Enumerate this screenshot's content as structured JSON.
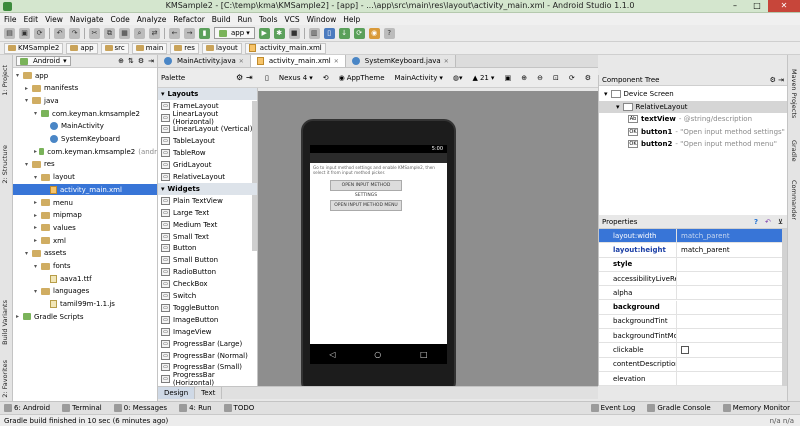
{
  "window": {
    "title": "KMSample2 - [C:\\temp\\kma\\KMSample2] - [app] - ...\\app\\src\\main\\res\\layout\\activity_main.xml - Android Studio 1.1.0",
    "minimize": "–",
    "maximize": "□",
    "close": "✕"
  },
  "menu": [
    "File",
    "Edit",
    "View",
    "Navigate",
    "Code",
    "Analyze",
    "Refactor",
    "Build",
    "Run",
    "Tools",
    "VCS",
    "Window",
    "Help"
  ],
  "toolbar": {
    "app_selector": "app"
  },
  "breadcrumbs": [
    "KMSample2",
    "app",
    "src",
    "main",
    "res",
    "layout",
    "activity_main.xml"
  ],
  "left_tabs": [
    "1: Project",
    "2: Structure",
    "Build Variants",
    "2: Favorites"
  ],
  "right_tabs": [
    "Maven Projects",
    "Gradle",
    "Commander"
  ],
  "project": {
    "view": "Android",
    "tree": [
      {
        "label": "app",
        "indent": 0,
        "icon": "folder",
        "arrow": "▾"
      },
      {
        "label": "manifests",
        "indent": 1,
        "icon": "folder",
        "arrow": "▸"
      },
      {
        "label": "java",
        "indent": 1,
        "icon": "folder",
        "arrow": "▾"
      },
      {
        "label": "com.keyman.kmsample2",
        "indent": 2,
        "icon": "package",
        "arrow": "▾"
      },
      {
        "label": "MainActivity",
        "indent": 3,
        "icon": "class",
        "arrow": ""
      },
      {
        "label": "SystemKeyboard",
        "indent": 3,
        "icon": "class",
        "arrow": ""
      },
      {
        "label": "com.keyman.kmsample2",
        "suffix": "(andr",
        "indent": 2,
        "icon": "package",
        "arrow": "▸"
      },
      {
        "label": "res",
        "indent": 1,
        "icon": "folder",
        "arrow": "▾"
      },
      {
        "label": "layout",
        "indent": 2,
        "icon": "folder",
        "arrow": "▾"
      },
      {
        "label": "activity_main.xml",
        "indent": 3,
        "icon": "xml",
        "arrow": "",
        "selected": true
      },
      {
        "label": "menu",
        "indent": 2,
        "icon": "folder",
        "arrow": "▸"
      },
      {
        "label": "mipmap",
        "indent": 2,
        "icon": "folder",
        "arrow": "▸"
      },
      {
        "label": "values",
        "indent": 2,
        "icon": "folder",
        "arrow": "▸"
      },
      {
        "label": "xml",
        "indent": 2,
        "icon": "folder",
        "arrow": "▸"
      },
      {
        "label": "assets",
        "indent": 1,
        "icon": "folder",
        "arrow": "▾"
      },
      {
        "label": "fonts",
        "indent": 2,
        "icon": "folder",
        "arrow": "▾"
      },
      {
        "label": "aava1.ttf",
        "indent": 3,
        "icon": "file",
        "arrow": ""
      },
      {
        "label": "languages",
        "indent": 2,
        "icon": "folder",
        "arrow": "▾"
      },
      {
        "label": "tamil99m-1.1.js",
        "indent": 3,
        "icon": "file",
        "arrow": ""
      },
      {
        "label": "Gradle Scripts",
        "indent": 0,
        "icon": "gradle",
        "arrow": "▸"
      }
    ]
  },
  "editor_tabs": [
    {
      "label": "MainActivity.java",
      "active": false
    },
    {
      "label": "activity_main.xml",
      "active": true
    },
    {
      "label": "SystemKeyboard.java",
      "active": false
    }
  ],
  "palette": {
    "title": "Palette",
    "items": [
      {
        "label": "Layouts",
        "cat": true
      },
      {
        "label": "FrameLayout"
      },
      {
        "label": "LinearLayout (Horizontal)"
      },
      {
        "label": "LinearLayout (Vertical)"
      },
      {
        "label": "TableLayout"
      },
      {
        "label": "TableRow"
      },
      {
        "label": "GridLayout"
      },
      {
        "label": "RelativeLayout"
      },
      {
        "label": "Widgets",
        "cat": true
      },
      {
        "label": "Plain TextView"
      },
      {
        "label": "Large Text"
      },
      {
        "label": "Medium Text"
      },
      {
        "label": "Small Text"
      },
      {
        "label": "Button"
      },
      {
        "label": "Small Button"
      },
      {
        "label": "RadioButton"
      },
      {
        "label": "CheckBox"
      },
      {
        "label": "Switch"
      },
      {
        "label": "ToggleButton"
      },
      {
        "label": "ImageButton"
      },
      {
        "label": "ImageView"
      },
      {
        "label": "ProgressBar (Large)"
      },
      {
        "label": "ProgressBar (Normal)"
      },
      {
        "label": "ProgressBar (Small)"
      },
      {
        "label": "ProgressBar (Horizontal)"
      }
    ]
  },
  "canvas_toolbar": {
    "device": "Nexus 4",
    "theme": "AppTheme",
    "activity": "MainActivity",
    "api": "21"
  },
  "device_preview": {
    "time": "5:00",
    "description": "Go to input method settings and enable KMSample2, then select it from input method picker.",
    "button1": "OPEN INPUT METHOD SETTINGS",
    "button2": "OPEN INPUT METHOD MENU",
    "nav": [
      "◁",
      "○",
      "□"
    ]
  },
  "design_tabs": [
    "Design",
    "Text"
  ],
  "component_tree": {
    "title": "Component Tree",
    "rows": [
      {
        "label": "Device Screen",
        "indent": 0
      },
      {
        "label": "RelativeLayout",
        "indent": 1,
        "selected": true
      },
      {
        "label": "textView",
        "detail": "- @string/description",
        "indent": 2,
        "ic": "Ab"
      },
      {
        "label": "button1",
        "detail": "- \"Open input method settings\"",
        "indent": 2,
        "ic": "OK"
      },
      {
        "label": "button2",
        "detail": "- \"Open input method menu\"",
        "indent": 2,
        "ic": "OK"
      }
    ]
  },
  "properties": {
    "title": "Properties",
    "rows": [
      {
        "k": "layout:width",
        "v": "match_parent",
        "selected": true
      },
      {
        "k": "layout:height",
        "v": "match_parent",
        "style": "blue"
      },
      {
        "k": "style",
        "v": "",
        "style": "bold"
      },
      {
        "k": "accessibilityLiveRegion",
        "v": ""
      },
      {
        "k": "alpha",
        "v": ""
      },
      {
        "k": "background",
        "v": "",
        "style": "bold"
      },
      {
        "k": "backgroundTint",
        "v": ""
      },
      {
        "k": "backgroundTintMode",
        "v": ""
      },
      {
        "k": "clickable",
        "v": "",
        "checkbox": true
      },
      {
        "k": "contentDescription",
        "v": ""
      },
      {
        "k": "elevation",
        "v": ""
      }
    ]
  },
  "tool_windows": [
    {
      "label": "6: Android"
    },
    {
      "label": "Terminal"
    },
    {
      "label": "0: Messages"
    },
    {
      "label": "4: Run"
    },
    {
      "label": "TODO"
    }
  ],
  "tool_windows_right": [
    {
      "label": "Event Log"
    },
    {
      "label": "Gradle Console"
    },
    {
      "label": "Memory Monitor"
    }
  ],
  "status": {
    "message": "Gradle build finished in 10 sec (6 minutes ago)",
    "right": "n/a   n/a"
  }
}
